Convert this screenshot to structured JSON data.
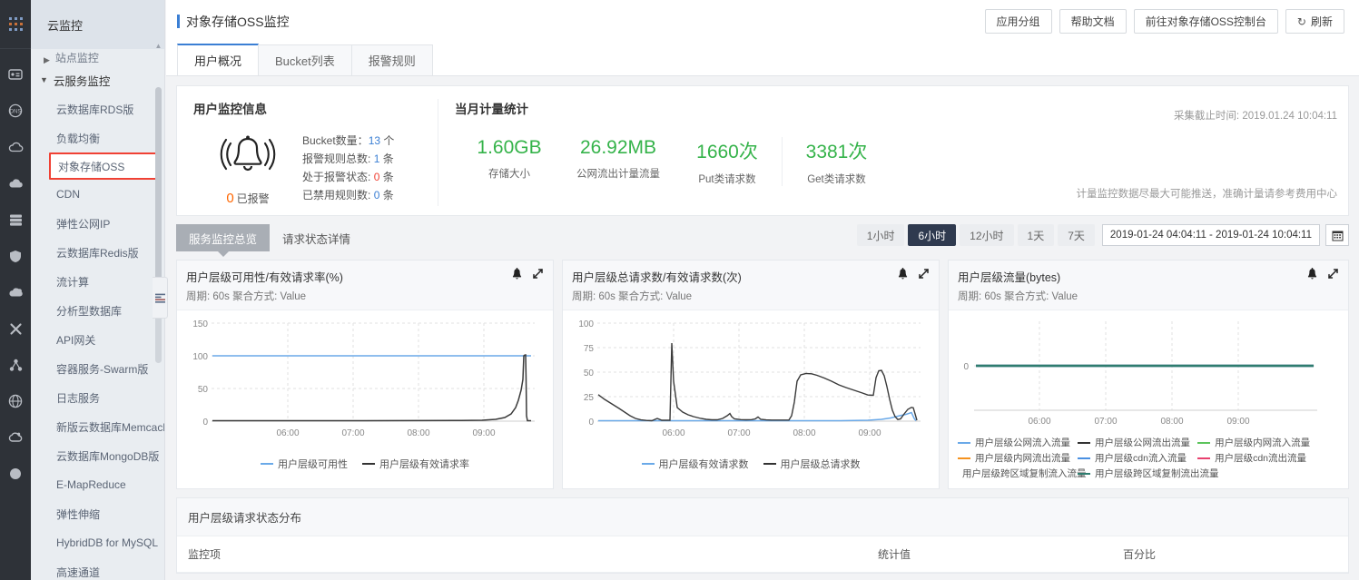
{
  "rail": {
    "icons": [
      "apps-grid-icon",
      "ecs-server-icon",
      "dns-globe-icon",
      "cloud-outline-icon",
      "cloud-filled-icon",
      "database-stack-icon",
      "shield-icon",
      "cloud-upload-icon",
      "network-cross-icon",
      "nodes-share-icon",
      "globe-grid-icon",
      "cloud-monitor-icon",
      "circle-dot-icon"
    ]
  },
  "sidebar": {
    "title": "云监控",
    "cut_item": "站点监控",
    "group_label": "云服务监控",
    "items": [
      {
        "label": "云数据库RDS版",
        "selected": false
      },
      {
        "label": "负载均衡",
        "selected": false
      },
      {
        "label": "对象存储OSS",
        "selected": true
      },
      {
        "label": "CDN",
        "selected": false
      },
      {
        "label": "弹性公网IP",
        "selected": false
      },
      {
        "label": "云数据库Redis版",
        "selected": false
      },
      {
        "label": "流计算",
        "selected": false
      },
      {
        "label": "分析型数据库",
        "selected": false
      },
      {
        "label": "API网关",
        "selected": false
      },
      {
        "label": "容器服务-Swarm版",
        "selected": false
      },
      {
        "label": "日志服务",
        "selected": false
      },
      {
        "label": "新版云数据库Memcache",
        "selected": false
      },
      {
        "label": "云数据库MongoDB版",
        "selected": false
      },
      {
        "label": "E-MapReduce",
        "selected": false
      },
      {
        "label": "弹性伸缩",
        "selected": false
      },
      {
        "label": "HybridDB for MySQL",
        "selected": false
      },
      {
        "label": "高速通道",
        "selected": false
      }
    ],
    "scroll_up_icon": "caret-up-icon",
    "collapse_icon": "collapse-panel-icon"
  },
  "topbar": {
    "page_title": "对象存储OSS监控",
    "buttons": [
      {
        "label": "应用分组",
        "icon": null
      },
      {
        "label": "帮助文档",
        "icon": null
      },
      {
        "label": "前往对象存储OSS控制台",
        "icon": null
      },
      {
        "label": "刷新",
        "icon": "refresh-icon",
        "glyph": "↻"
      }
    ]
  },
  "tabs": [
    {
      "label": "用户概况",
      "active": true
    },
    {
      "label": "Bucket列表",
      "active": false
    },
    {
      "label": "报警规则",
      "active": false
    }
  ],
  "summary": {
    "left_title": "用户监控信息",
    "bell_icon": "alarm-bell-icon",
    "alarm_count": "0",
    "alarm_label": "已报警",
    "stats": [
      {
        "label": "Bucket数量：",
        "value": "13",
        "unit": "个"
      },
      {
        "label": "报警规则总数:",
        "value": "1",
        "unit": "条"
      },
      {
        "label": "处于报警状态:",
        "value": "0",
        "unit": "条"
      },
      {
        "label": "已禁用规则数:",
        "value": "0",
        "unit": "条"
      }
    ],
    "right_title": "当月计量统计",
    "collect_time": "采集截止时间: 2019.01.24 10:04:11",
    "fee_note": "计量监控数据尽最大可能推送，准确计量请参考费用中心",
    "metrics": [
      {
        "value": "1.60GB",
        "label": "存储大小"
      },
      {
        "value": "26.92MB",
        "label": "公网流出计量流量"
      },
      {
        "value": "1660次",
        "label": "Put类请求数"
      },
      {
        "value": "3381次",
        "label": "Get类请求数"
      }
    ]
  },
  "subtabs": [
    {
      "label": "服务监控总览",
      "active": true
    },
    {
      "label": "请求状态详情",
      "active": false
    }
  ],
  "range": {
    "buttons": [
      {
        "label": "1小时",
        "active": false
      },
      {
        "label": "6小时",
        "active": true
      },
      {
        "label": "12小时",
        "active": false
      },
      {
        "label": "1天",
        "active": false
      },
      {
        "label": "7天",
        "active": false
      }
    ],
    "value": "2019-01-24 04:04:11 - 2019-01-24 10:04:11",
    "calendar_icon": "calendar-icon"
  },
  "chart_data": [
    {
      "type": "line",
      "title": "用户层级可用性/有效请求率(%)",
      "subtitle": "周期: 60s  聚合方式: Value",
      "bell_icon": "alarm-bell-icon",
      "expand_icon": "expand-arrows-icon",
      "xlabel": "",
      "ylabel": "",
      "ylim": [
        0,
        150
      ],
      "yticks": [
        0,
        50,
        100,
        150
      ],
      "xticks": [
        "06:00",
        "07:00",
        "08:00",
        "09:00"
      ],
      "grid": true,
      "legend_position": "bottom",
      "series": [
        {
          "name": "用户层级可用性",
          "color": "#6aa9e8",
          "x": [
            0,
            10,
            20,
            30,
            40,
            50,
            60,
            70,
            80,
            90,
            95,
            97,
            100
          ],
          "values": [
            100,
            100,
            100,
            100,
            100,
            100,
            100,
            100,
            100,
            100,
            100,
            100,
            100
          ]
        },
        {
          "name": "用户层级有效请求率",
          "color": "#333333",
          "x": [
            0,
            10,
            20,
            30,
            40,
            50,
            60,
            70,
            80,
            85,
            88,
            90,
            92,
            93,
            94,
            95,
            96,
            97,
            97.5,
            98,
            98.5,
            99,
            99.5,
            100
          ],
          "values": [
            0.5,
            0.5,
            0.5,
            0.5,
            0.5,
            0.5,
            0.5,
            0.5,
            0.5,
            0.8,
            1.5,
            3,
            7,
            12,
            18,
            25,
            32,
            34,
            100,
            102,
            100,
            60,
            20,
            1
          ]
        }
      ]
    },
    {
      "type": "line",
      "title": "用户层级总请求数/有效请求数(次)",
      "subtitle": "周期: 60s  聚合方式: Value",
      "bell_icon": "alarm-bell-icon",
      "expand_icon": "expand-arrows-icon",
      "xlabel": "",
      "ylabel": "",
      "ylim": [
        0,
        100
      ],
      "yticks": [
        0,
        25,
        50,
        75,
        100
      ],
      "xticks": [
        "06:00",
        "07:00",
        "08:00",
        "09:00"
      ],
      "grid": true,
      "legend_position": "bottom",
      "series": [
        {
          "name": "用户层级有效请求数",
          "color": "#6aa9e8",
          "x": [
            0,
            10,
            20,
            30,
            40,
            50,
            60,
            70,
            80,
            85,
            90,
            93,
            95,
            97,
            98,
            99,
            100
          ],
          "values": [
            0.5,
            0.5,
            0.5,
            0.5,
            0.5,
            0.5,
            0.5,
            0.5,
            0.5,
            0.6,
            1,
            2,
            3,
            4.5,
            5.5,
            6.5,
            2
          ]
        },
        {
          "name": "用户层级总请求数",
          "color": "#333333",
          "x": [
            0,
            2,
            4,
            6,
            8,
            10,
            12,
            14,
            16,
            18,
            19,
            20,
            21,
            22,
            24,
            26,
            28,
            30,
            32,
            34,
            35,
            36,
            38,
            40,
            42,
            44,
            46,
            48,
            50,
            52,
            54,
            55,
            56,
            58,
            60,
            62,
            64,
            66,
            68,
            70,
            72,
            74,
            75,
            76,
            77,
            78,
            80,
            82,
            84,
            86,
            88,
            90,
            92,
            94,
            96,
            98,
            99,
            100
          ],
          "values": [
            27,
            22,
            18,
            14,
            11,
            8,
            5,
            3,
            1.5,
            1,
            5,
            79,
            40,
            14,
            9,
            6,
            4,
            3,
            2.5,
            2,
            2.5,
            3,
            8,
            4,
            2,
            2,
            2,
            2,
            3,
            4,
            3,
            2,
            2,
            2,
            2,
            2,
            25,
            40,
            41,
            40,
            38,
            33,
            31,
            28,
            25,
            23,
            22,
            21,
            21,
            46,
            45,
            30,
            12,
            2,
            4,
            12,
            17,
            8
          ]
        }
      ]
    },
    {
      "type": "line",
      "title": "用户层级流量(bytes)",
      "subtitle": "周期: 60s  聚合方式: Value",
      "bell_icon": "alarm-bell-icon",
      "expand_icon": "expand-arrows-icon",
      "xlabel": "",
      "ylabel": "",
      "ylim": [
        -1,
        1
      ],
      "yticks": [
        0
      ],
      "xticks": [
        "06:00",
        "07:00",
        "08:00",
        "09:00"
      ],
      "grid": true,
      "legend_position": "bottom",
      "series": [
        {
          "name": "用户层级公网流入流量",
          "color": "#6aa9e8",
          "x": [
            0,
            100
          ],
          "values": [
            0,
            0
          ]
        },
        {
          "name": "用户层级公网流出流量",
          "color": "#333333",
          "x": [
            0,
            100
          ],
          "values": [
            0,
            0
          ]
        },
        {
          "name": "用户层级内网流入流量",
          "color": "#5cc45c",
          "x": [
            0,
            100
          ],
          "values": [
            0,
            0
          ]
        },
        {
          "name": "用户层级内网流出流量",
          "color": "#f5921e",
          "x": [
            0,
            100
          ],
          "values": [
            0,
            0
          ]
        },
        {
          "name": "用户层级cdn流入流量",
          "color": "#4a90e2",
          "x": [
            0,
            100
          ],
          "values": [
            0,
            0
          ]
        },
        {
          "name": "用户层级cdn流出流量",
          "color": "#e8416f",
          "x": [
            0,
            100
          ],
          "values": [
            0,
            0
          ]
        },
        {
          "name": "用户层级跨区域复制流入流量",
          "color": "#f0c419",
          "x": [
            0,
            100
          ],
          "values": [
            0,
            0
          ]
        },
        {
          "name": "用户层级跨区域复制流出流量",
          "color": "#1f7a6d",
          "x": [
            0,
            100
          ],
          "values": [
            0,
            0
          ]
        }
      ]
    }
  ],
  "distribution": {
    "title": "用户层级请求状态分布",
    "columns": [
      "监控项",
      "统计值",
      "百分比"
    ]
  }
}
